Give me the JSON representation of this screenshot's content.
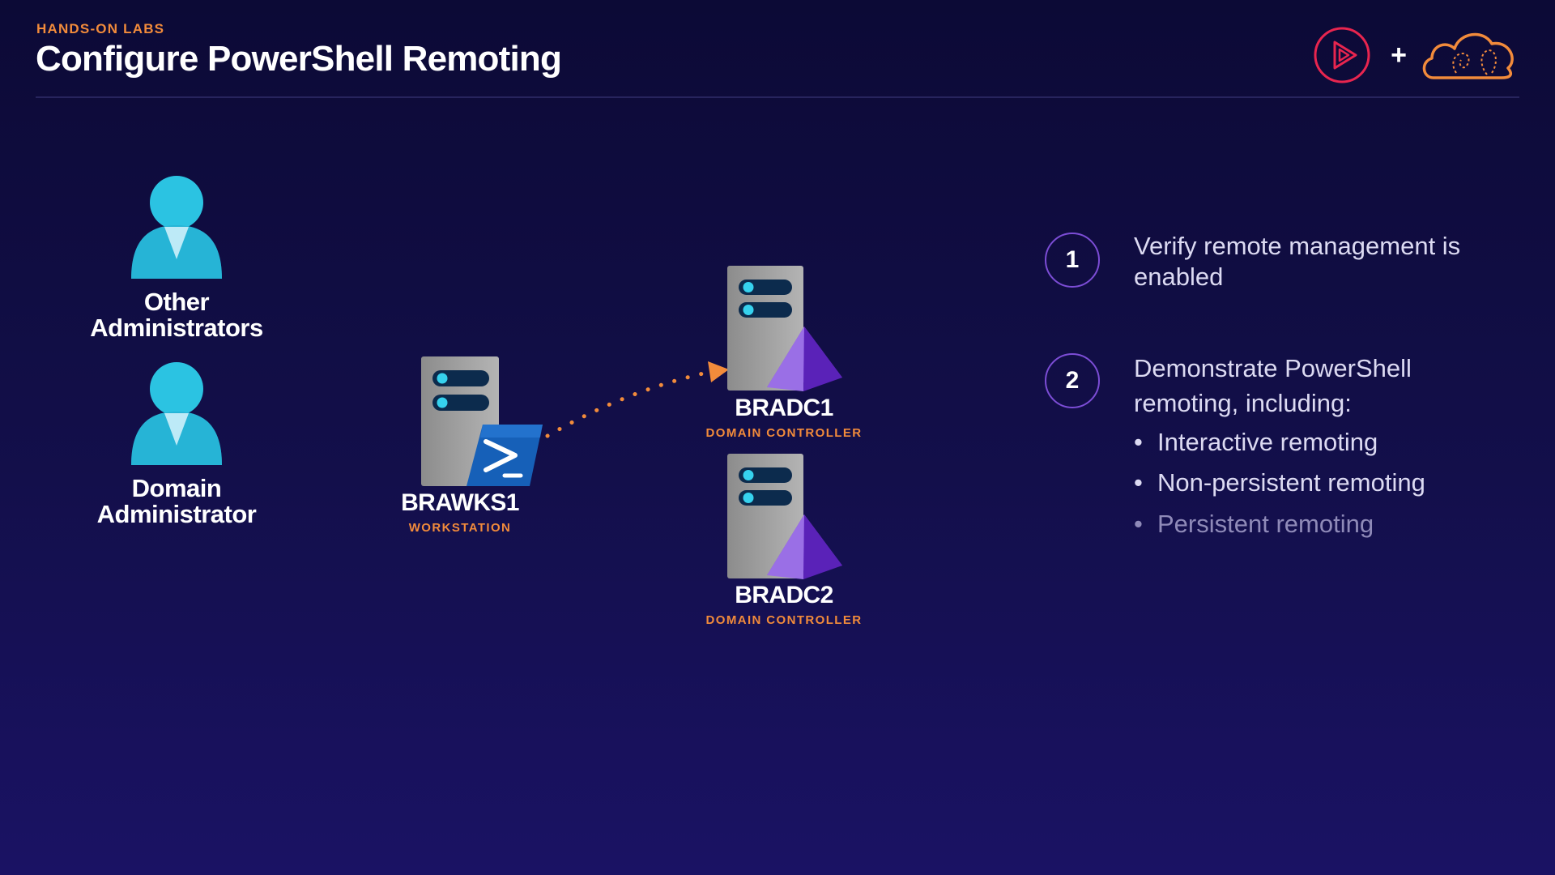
{
  "header": {
    "eyebrow": "HANDS-ON LABS",
    "title": "Configure PowerShell Remoting",
    "plus_sign": "+"
  },
  "people": [
    {
      "label": "Other\nAdministrators"
    },
    {
      "label": "Domain\nAdministrator"
    }
  ],
  "nodes": {
    "workstation": {
      "name": "BRAWKS1",
      "role": "WORKSTATION"
    },
    "dc1": {
      "name": "BRADC1",
      "role": "DOMAIN CONTROLLER"
    },
    "dc2": {
      "name": "BRADC2",
      "role": "DOMAIN CONTROLLER"
    }
  },
  "steps": [
    {
      "number": "1",
      "text": "Verify remote management is enabled"
    },
    {
      "number": "2",
      "text": "Demonstrate PowerShell remoting, including:"
    }
  ],
  "bullets": [
    {
      "text": "Interactive remoting"
    },
    {
      "text": "Non-persistent remoting"
    },
    {
      "text": "Persistent remoting"
    }
  ],
  "colors": {
    "background": "#130f4b",
    "accent_orange": "#f28b3b",
    "person_cyan": "#2bc3e2",
    "powershell_blue": "#1660b8",
    "prism_purple": "#7b3fd9",
    "pluralsight_red": "#e8254f",
    "step_circle": "#7c4dd6"
  },
  "icons": {
    "person": "person-icon",
    "server": "server-icon",
    "powershell": "powershell-icon",
    "domain_prism": "prism-icon",
    "connection": "dotted-arrow"
  }
}
